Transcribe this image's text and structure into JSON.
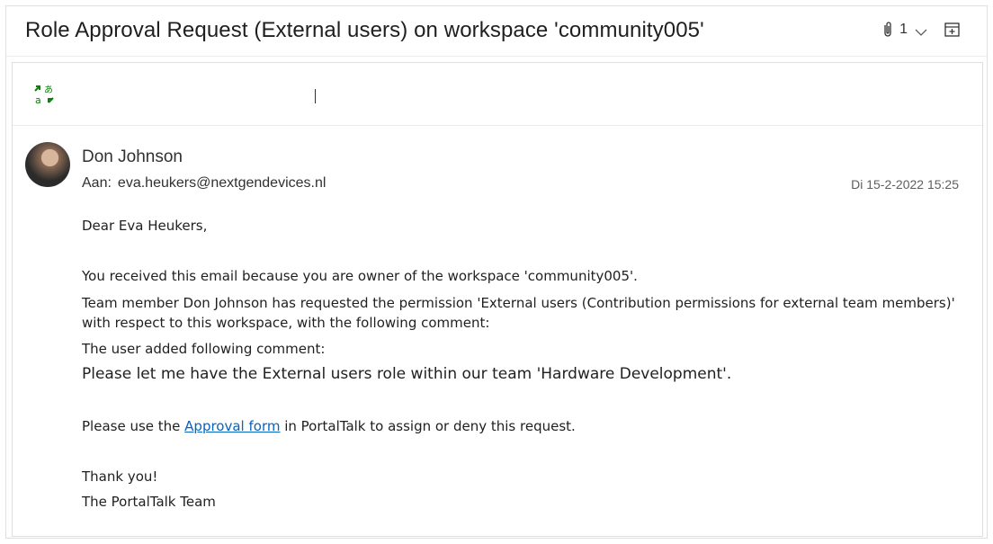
{
  "email": {
    "subject": "Role Approval Request (External users) on workspace 'community005'",
    "attachment_count": "1",
    "sender_name": "Don Johnson",
    "to_label": "Aan:",
    "to_address": "eva.heukers@nextgendevices.nl",
    "date": "Di 15-2-2022 15:25"
  },
  "body": {
    "greeting": "Dear Eva Heukers,",
    "para1": "You received this email because you are owner of the workspace 'community005'.",
    "para2_line1": "Team member Don Johnson has requested the permission 'External users (Contribution permissions for external team members)'",
    "para2_line2": "with respect to this workspace, with the following comment:",
    "comment_intro": "The user added following comment:",
    "comment": "Please let me have the External users role within our team 'Hardware Development'.",
    "instruction_pre": "Please use the ",
    "instruction_link": "Approval form",
    "instruction_post": " in PortalTalk to assign or deny this request.",
    "thanks": "Thank you!",
    "signature": "The PortalTalk Team"
  },
  "colors": {
    "link": "#0563c1",
    "translate_icon": "#107c10"
  }
}
